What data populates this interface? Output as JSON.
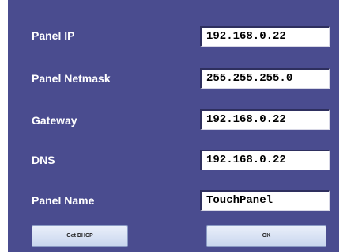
{
  "fields": [
    {
      "label": "Panel IP",
      "value": "192.168.0.22"
    },
    {
      "label": "Panel Netmask",
      "value": "255.255.255.0"
    },
    {
      "label": "Gateway",
      "value": "192.168.0.22"
    },
    {
      "label": "DNS",
      "value": "192.168.0.22"
    },
    {
      "label": "Panel Name",
      "value": "TouchPanel"
    }
  ],
  "buttons": {
    "get_dhcp": "Get DHCP",
    "ok": "OK"
  },
  "colors": {
    "panel_background": "#4a4c8f",
    "label_text": "#ffffff",
    "field_background": "#ffffff"
  }
}
